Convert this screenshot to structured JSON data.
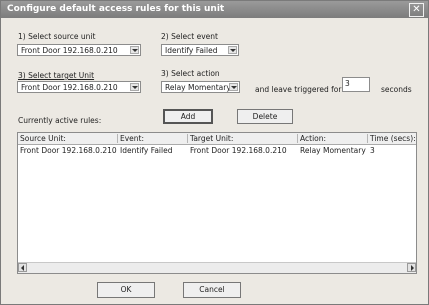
{
  "window": {
    "title": "Configure default access rules for this unit",
    "close_glyph": "✕"
  },
  "form": {
    "source_label": "1) Select source unit",
    "source_value": "Front Door 192.168.0.210",
    "event_label": "2) Select event",
    "event_value": "Identify Failed",
    "target_label": "3) Select target Unit",
    "target_value": "Front Door 192.168.0.210",
    "action_label": "3) Select action",
    "action_value": "Relay Momentary",
    "leave_label": "and leave triggered for",
    "seconds_value": "3",
    "seconds_label": "seconds"
  },
  "rules": {
    "label": "Currently active rules:",
    "add_label": "Add",
    "delete_label": "Delete",
    "columns": [
      "Source Unit:",
      "Event:",
      "Target Unit:",
      "Action:",
      "Time (secs):"
    ],
    "rows": [
      [
        "Front Door 192.168.0.210",
        "Identify Failed",
        "Front Door 192.168.0.210",
        "Relay Momentary",
        "3"
      ]
    ]
  },
  "footer": {
    "ok_label": "OK",
    "cancel_label": "Cancel"
  },
  "icons": {
    "close": "close-icon",
    "dropdown": "chevron-down-icon",
    "scroll_left": "arrow-left-icon",
    "scroll_right": "arrow-right-icon"
  }
}
